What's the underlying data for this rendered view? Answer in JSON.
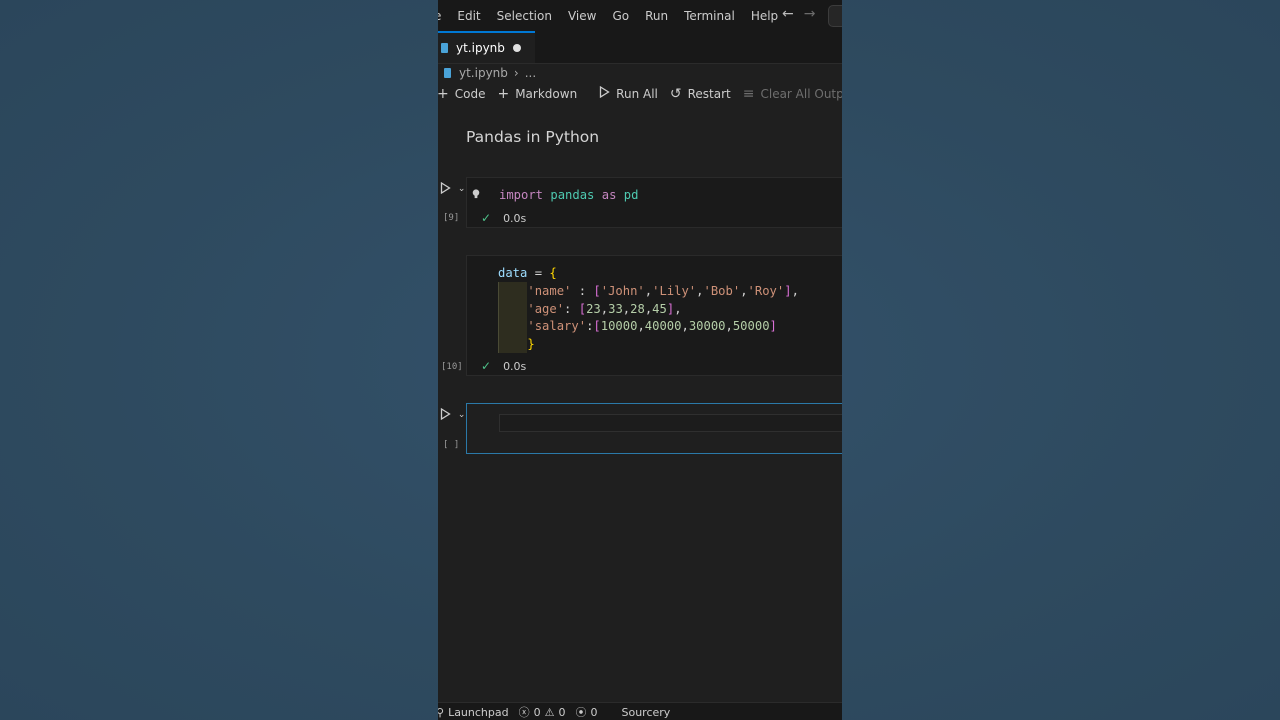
{
  "menu": [
    "Edit",
    "Selection",
    "View",
    "Go",
    "Run",
    "Terminal",
    "Help"
  ],
  "menu_partial": "e",
  "nav": {
    "back": "←",
    "forward": "→"
  },
  "tab": {
    "filename": "yt.ipynb",
    "modified_icon": "dot-icon"
  },
  "breadcrumb": {
    "file": "yt.ipynb",
    "rest": "..."
  },
  "toolbar": {
    "code": "Code",
    "markdown": "Markdown",
    "run_all": "Run All",
    "restart": "Restart",
    "clear_all_outputs": "Clear All Outputs"
  },
  "markdown_title": "Pandas in Python",
  "cells": [
    {
      "exec_count": "[9]",
      "time": "0.0s"
    },
    {
      "exec_count": "[10]",
      "time": "0.0s"
    },
    {
      "exec_count": "[ ]"
    }
  ],
  "statusbar": {
    "launchpad": "Launchpad",
    "errors": "0",
    "warnings": "0",
    "ports": "0",
    "sourcery": "Sourcery"
  },
  "colors": {
    "accent": "#0078d4",
    "success": "#4ec28a",
    "background": "#2f4a5e"
  }
}
